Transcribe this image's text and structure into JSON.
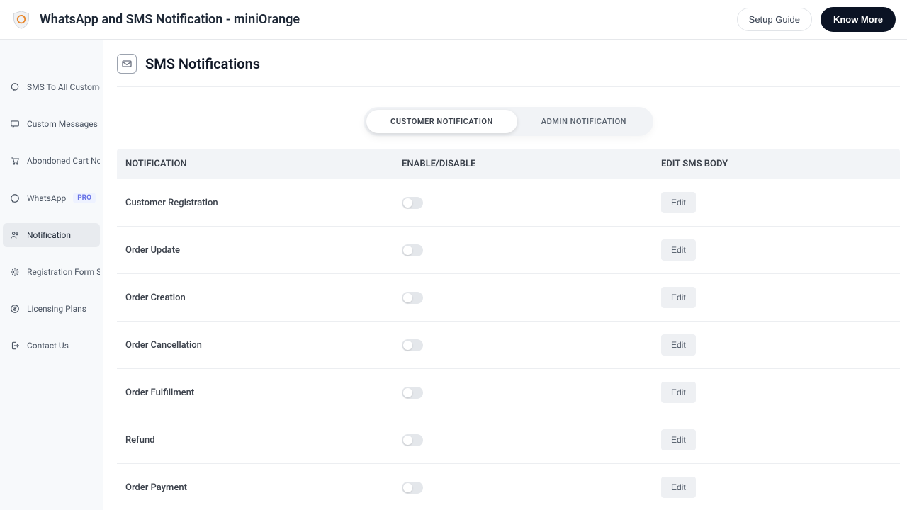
{
  "header": {
    "title": "WhatsApp and SMS Notification - miniOrange",
    "setup_guide": "Setup Guide",
    "know_more": "Know More"
  },
  "sidebar": {
    "items": [
      {
        "label": "SMS To All Customers",
        "icon": "chat-icon"
      },
      {
        "label": "Custom Messages",
        "icon": "message-icon"
      },
      {
        "label": "Abondoned Cart Noti...",
        "icon": "cart-icon"
      },
      {
        "label": "WhatsApp",
        "icon": "whatsapp-icon",
        "badge": "PRO"
      },
      {
        "label": "Notification",
        "icon": "users-icon",
        "active": true
      },
      {
        "label": "Registration Form Set...",
        "icon": "gear-icon"
      },
      {
        "label": "Licensing Plans",
        "icon": "dollar-icon"
      },
      {
        "label": "Contact Us",
        "icon": "logout-icon"
      }
    ]
  },
  "page": {
    "title": "SMS Notifications",
    "tabs": {
      "customer": "CUSTOMER NOTIFICATION",
      "admin": "ADMIN NOTIFICATION"
    },
    "columns": {
      "notification": "NOTIFICATION",
      "enable": "ENABLE/DISABLE",
      "edit": "EDIT SMS BODY"
    },
    "edit_label": "Edit",
    "rows": [
      {
        "name": "Customer Registration"
      },
      {
        "name": "Order Update"
      },
      {
        "name": "Order Creation"
      },
      {
        "name": "Order Cancellation"
      },
      {
        "name": "Order Fulfillment"
      },
      {
        "name": "Refund"
      },
      {
        "name": "Order Payment"
      }
    ]
  }
}
